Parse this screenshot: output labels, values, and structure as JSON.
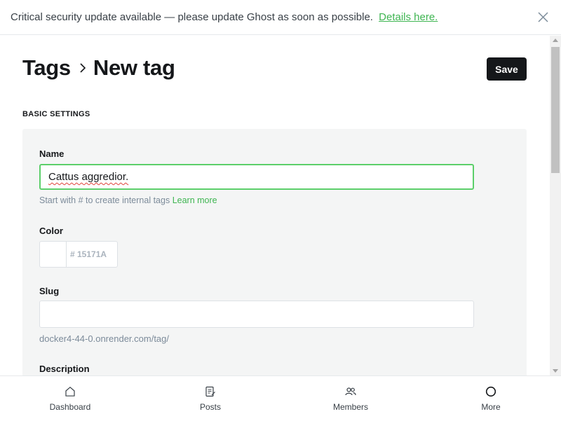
{
  "banner": {
    "text": "Critical security update available — please update Ghost as soon as possible.",
    "link": "Details here."
  },
  "header": {
    "breadcrumb_parent": "Tags",
    "title": "New tag",
    "save_label": "Save"
  },
  "basic_settings": {
    "section_label": "BASIC SETTINGS",
    "name_label": "Name",
    "name_value": "Cattus aggredior.",
    "name_hint": "Start with # to create internal tags",
    "name_hint_link": "Learn more",
    "color_label": "Color",
    "color_placeholder": "# 15171A",
    "slug_label": "Slug",
    "slug_url": "docker4-44-0.onrender.com/tag/",
    "description_label": "Description"
  },
  "bottom_nav": [
    {
      "label": "Dashboard",
      "icon": "home-icon"
    },
    {
      "label": "Posts",
      "icon": "posts-icon"
    },
    {
      "label": "Members",
      "icon": "members-icon"
    },
    {
      "label": "More",
      "icon": "more-icon"
    }
  ],
  "colors": {
    "accent_green": "#3eb551",
    "focus_border": "#5ccf6a",
    "primary_dark": "#15171a",
    "panel_bg": "#f4f5f5"
  }
}
